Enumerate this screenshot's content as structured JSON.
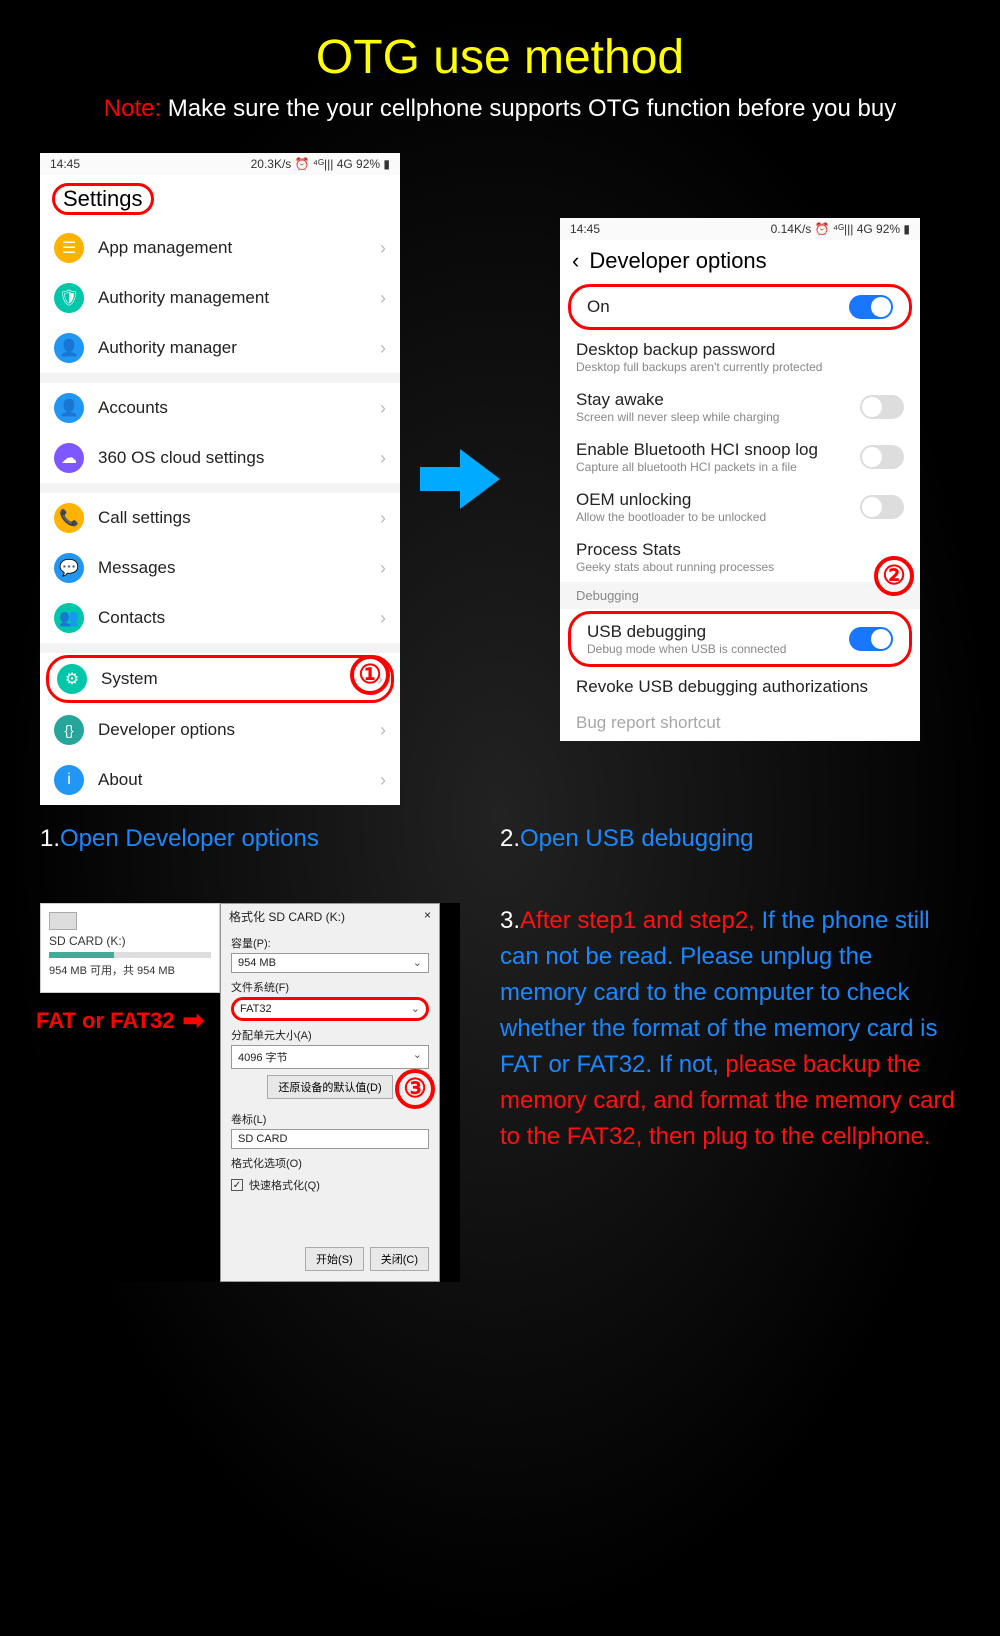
{
  "title": "OTG use method",
  "note_label": "Note:",
  "note_text": " Make sure the your cellphone supports OTG function before you buy",
  "phone_left": {
    "time": "14:45",
    "status_right": "20.3K/s ⏰ ⁴ᴳ||| 4G 92% ▮",
    "header": "Settings",
    "sections": [
      [
        {
          "label": "App management",
          "icon": "☰",
          "color": "#ffb300"
        },
        {
          "label": "Authority management",
          "icon": "🛡",
          "color": "#00c6aa"
        },
        {
          "label": "Authority manager",
          "icon": "👤",
          "color": "#2196f3"
        }
      ],
      [
        {
          "label": "Accounts",
          "icon": "👤",
          "color": "#2196f3"
        },
        {
          "label": "360 OS cloud settings",
          "icon": "☁",
          "color": "#7e57ff"
        }
      ],
      [
        {
          "label": "Call settings",
          "icon": "📞",
          "color": "#ffb300"
        },
        {
          "label": "Messages",
          "icon": "💬",
          "color": "#2196f3"
        },
        {
          "label": "Contacts",
          "icon": "👥",
          "color": "#00c6aa"
        }
      ],
      [
        {
          "label": "System",
          "icon": "⚙",
          "color": "#00c6aa",
          "highlight": true
        },
        {
          "label": "Developer options",
          "icon": "{}",
          "color": "#26a69a"
        },
        {
          "label": "About",
          "icon": "i",
          "color": "#2196f3"
        }
      ]
    ]
  },
  "phone_right": {
    "time": "14:45",
    "status_right": "0.14K/s ⏰ ⁴ᴳ||| 4G 92% ▮",
    "header": "Developer options",
    "rows": [
      {
        "type": "toggle_on_highlight",
        "label": "On"
      },
      {
        "type": "item",
        "label": "Desktop backup password",
        "sub": "Desktop full backups aren't currently protected"
      },
      {
        "type": "toggle_off",
        "label": "Stay awake",
        "sub": "Screen will never sleep while charging"
      },
      {
        "type": "toggle_off",
        "label": "Enable Bluetooth HCI snoop log",
        "sub": "Capture all bluetooth HCI packets in a file"
      },
      {
        "type": "toggle_off",
        "label": "OEM unlocking",
        "sub": "Allow the bootloader to be unlocked"
      },
      {
        "type": "item",
        "label": "Process Stats",
        "sub": "Geeky stats about running processes"
      },
      {
        "type": "section",
        "label": "Debugging"
      },
      {
        "type": "toggle_on_highlight",
        "label": "USB debugging",
        "sub": "Debug mode when USB is connected"
      },
      {
        "type": "item",
        "label": "Revoke USB debugging authorizations"
      },
      {
        "type": "item_faded",
        "label": "Bug report shortcut"
      }
    ]
  },
  "caption1_num": "1.",
  "caption1": "Open Developer options",
  "caption2_num": "2.",
  "caption2": "Open USB debugging",
  "fat_label": "FAT or FAT32",
  "sd_info": {
    "name": "SD CARD (K:)",
    "detail": "954 MB 可用，共 954 MB"
  },
  "format_dialog": {
    "title": "格式化 SD CARD (K:)",
    "close": "×",
    "capacity_label": "容量(P):",
    "capacity_value": "954 MB",
    "fs_label": "文件系统(F)",
    "fs_value": "FAT32",
    "alloc_label": "分配单元大小(A)",
    "alloc_value": "4096 字节",
    "reset_defaults": "还原设备的默认值(D)",
    "vol_label": "卷标(L)",
    "vol_value": "SD CARD",
    "options_label": "格式化选项(O)",
    "quick_format": "快速格式化(Q)",
    "start_btn": "开始(S)",
    "close_btn": "关闭(C)"
  },
  "step3": {
    "num": "3.",
    "red1": "After step1 and step2,",
    "blue": " If the phone still can not be read. Please unplug the memory card to the computer to check whether the format of the memory card is FAT or FAT32. If not, ",
    "red2": "please backup the memory card, and format the memory card to the FAT32, then plug to the cellphone."
  },
  "circle_nums": {
    "one": "①",
    "two": "②",
    "three": "③"
  }
}
